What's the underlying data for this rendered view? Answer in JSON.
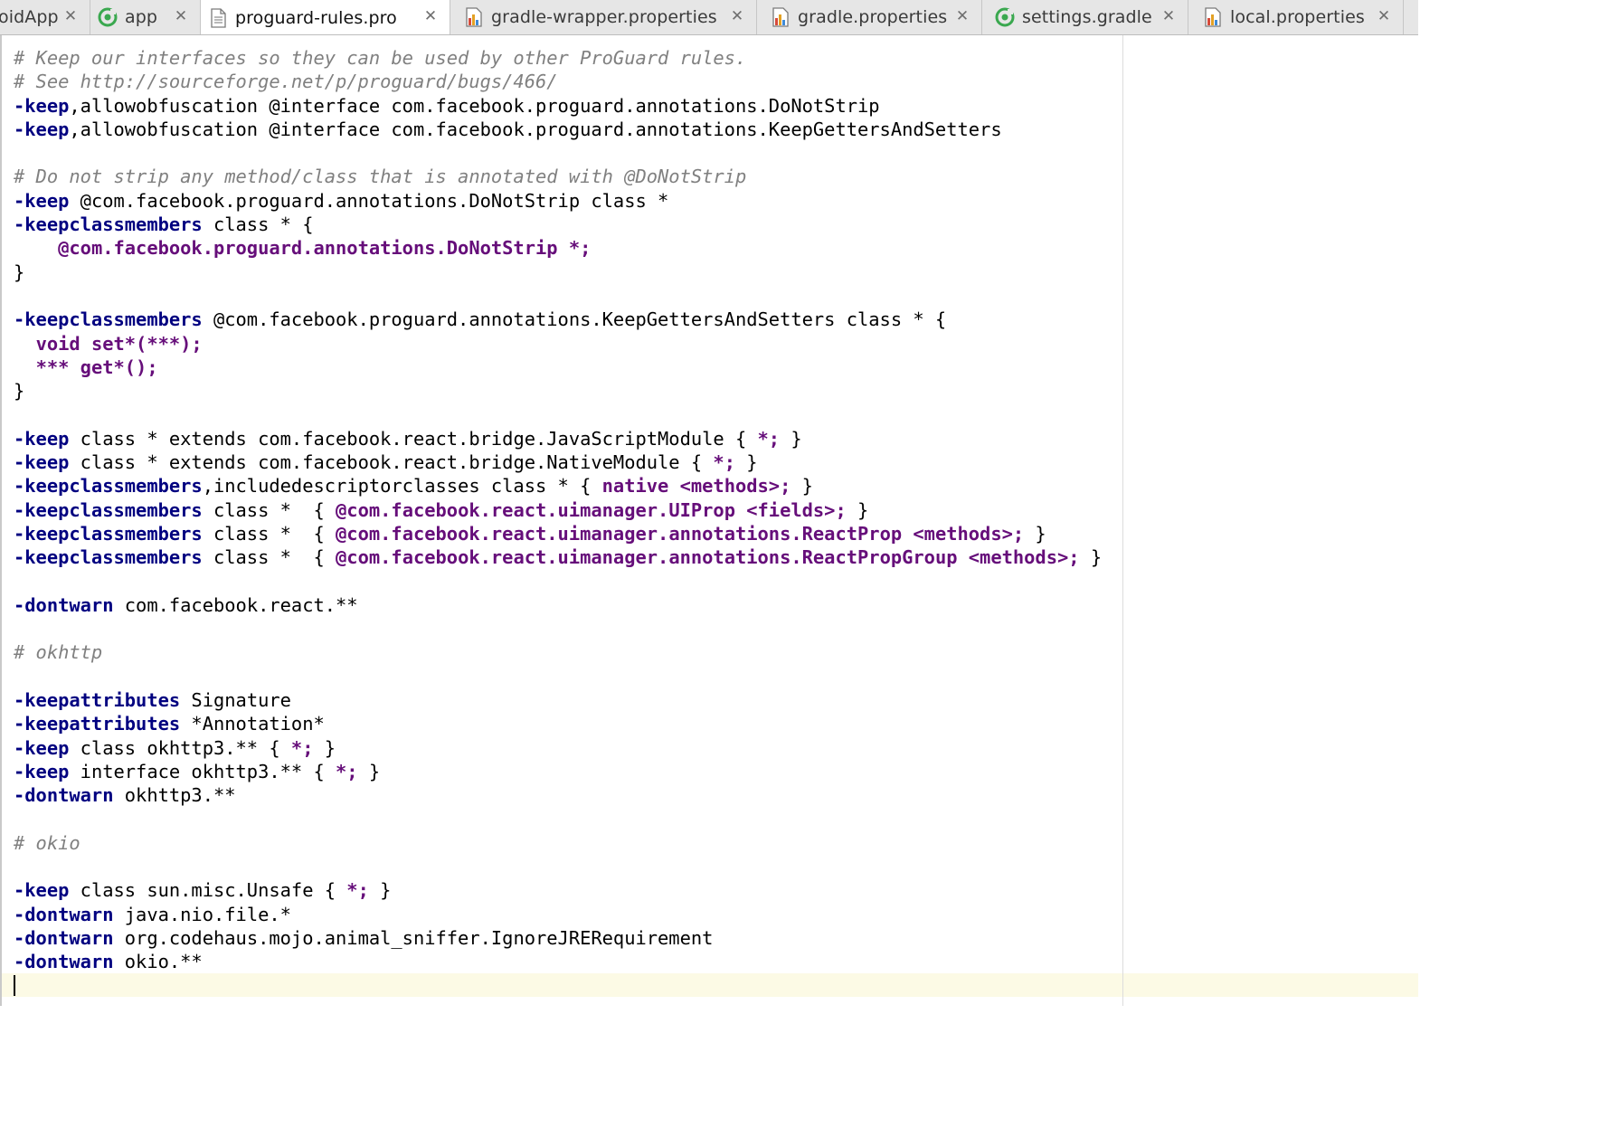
{
  "tabs": [
    {
      "label": "oidApp",
      "icon": "none",
      "active": false
    },
    {
      "label": "app",
      "icon": "gradle-module-icon",
      "active": false
    },
    {
      "label": "proguard-rules.pro",
      "icon": "text-file-icon",
      "active": true
    },
    {
      "label": "gradle-wrapper.properties",
      "icon": "properties-file-icon",
      "active": false
    },
    {
      "label": "gradle.properties",
      "icon": "properties-file-icon",
      "active": false
    },
    {
      "label": "settings.gradle",
      "icon": "gradle-module-icon",
      "active": false
    },
    {
      "label": "local.properties",
      "icon": "properties-file-icon",
      "active": false
    }
  ],
  "tab_close_glyph": "✕",
  "editor": {
    "file": "proguard-rules.pro",
    "colors": {
      "comment": "#808080",
      "keyword": "#000080",
      "member": "#660e7a",
      "current_line": "#fcfae5"
    },
    "lines": [
      [
        {
          "t": "comment",
          "v": "# Keep our interfaces so they can be used by other ProGuard rules."
        }
      ],
      [
        {
          "t": "comment",
          "v": "# See http://sourceforge.net/p/proguard/bugs/466/"
        }
      ],
      [
        {
          "t": "keyword",
          "v": "-keep"
        },
        {
          "t": "plain",
          "v": ",allowobfuscation @interface com.facebook.proguard.annotations.DoNotStrip"
        }
      ],
      [
        {
          "t": "keyword",
          "v": "-keep"
        },
        {
          "t": "plain",
          "v": ",allowobfuscation @interface com.facebook.proguard.annotations.KeepGettersAndSetters"
        }
      ],
      [],
      [
        {
          "t": "comment",
          "v": "# Do not strip any method/class that is annotated with @DoNotStrip"
        }
      ],
      [
        {
          "t": "keyword",
          "v": "-keep"
        },
        {
          "t": "plain",
          "v": " @com.facebook.proguard.annotations.DoNotStrip class *"
        }
      ],
      [
        {
          "t": "keyword",
          "v": "-keepclassmembers"
        },
        {
          "t": "plain",
          "v": " class * {"
        }
      ],
      [
        {
          "t": "plain",
          "v": "    "
        },
        {
          "t": "member",
          "v": "@com.facebook.proguard.annotations.DoNotStrip *;"
        }
      ],
      [
        {
          "t": "plain",
          "v": "}"
        }
      ],
      [],
      [
        {
          "t": "keyword",
          "v": "-keepclassmembers"
        },
        {
          "t": "plain",
          "v": " @com.facebook.proguard.annotations.KeepGettersAndSetters class * {"
        }
      ],
      [
        {
          "t": "plain",
          "v": "  "
        },
        {
          "t": "member",
          "v": "void set*(***);"
        }
      ],
      [
        {
          "t": "plain",
          "v": "  "
        },
        {
          "t": "member",
          "v": "*** get*();"
        }
      ],
      [
        {
          "t": "plain",
          "v": "}"
        }
      ],
      [],
      [
        {
          "t": "keyword",
          "v": "-keep"
        },
        {
          "t": "plain",
          "v": " class * extends com.facebook.react.bridge.JavaScriptModule { "
        },
        {
          "t": "member",
          "v": "*;"
        },
        {
          "t": "plain",
          "v": " }"
        }
      ],
      [
        {
          "t": "keyword",
          "v": "-keep"
        },
        {
          "t": "plain",
          "v": " class * extends com.facebook.react.bridge.NativeModule { "
        },
        {
          "t": "member",
          "v": "*;"
        },
        {
          "t": "plain",
          "v": " }"
        }
      ],
      [
        {
          "t": "keyword",
          "v": "-keepclassmembers"
        },
        {
          "t": "plain",
          "v": ",includedescriptorclasses class * { "
        },
        {
          "t": "member",
          "v": "native <methods>;"
        },
        {
          "t": "plain",
          "v": " }"
        }
      ],
      [
        {
          "t": "keyword",
          "v": "-keepclassmembers"
        },
        {
          "t": "plain",
          "v": " class *  { "
        },
        {
          "t": "member",
          "v": "@com.facebook.react.uimanager.UIProp <fields>;"
        },
        {
          "t": "plain",
          "v": " }"
        }
      ],
      [
        {
          "t": "keyword",
          "v": "-keepclassmembers"
        },
        {
          "t": "plain",
          "v": " class *  { "
        },
        {
          "t": "member",
          "v": "@com.facebook.react.uimanager.annotations.ReactProp <methods>;"
        },
        {
          "t": "plain",
          "v": " }"
        }
      ],
      [
        {
          "t": "keyword",
          "v": "-keepclassmembers"
        },
        {
          "t": "plain",
          "v": " class *  { "
        },
        {
          "t": "member",
          "v": "@com.facebook.react.uimanager.annotations.ReactPropGroup <methods>;"
        },
        {
          "t": "plain",
          "v": " }"
        }
      ],
      [],
      [
        {
          "t": "keyword",
          "v": "-dontwarn"
        },
        {
          "t": "plain",
          "v": " com.facebook.react.**"
        }
      ],
      [],
      [
        {
          "t": "comment",
          "v": "# okhttp"
        }
      ],
      [],
      [
        {
          "t": "keyword",
          "v": "-keepattributes"
        },
        {
          "t": "plain",
          "v": " Signature"
        }
      ],
      [
        {
          "t": "keyword",
          "v": "-keepattributes"
        },
        {
          "t": "plain",
          "v": " *Annotation*"
        }
      ],
      [
        {
          "t": "keyword",
          "v": "-keep"
        },
        {
          "t": "plain",
          "v": " class okhttp3.** { "
        },
        {
          "t": "member",
          "v": "*;"
        },
        {
          "t": "plain",
          "v": " }"
        }
      ],
      [
        {
          "t": "keyword",
          "v": "-keep"
        },
        {
          "t": "plain",
          "v": " interface okhttp3.** { "
        },
        {
          "t": "member",
          "v": "*;"
        },
        {
          "t": "plain",
          "v": " }"
        }
      ],
      [
        {
          "t": "keyword",
          "v": "-dontwarn"
        },
        {
          "t": "plain",
          "v": " okhttp3.**"
        }
      ],
      [],
      [
        {
          "t": "comment",
          "v": "# okio"
        }
      ],
      [],
      [
        {
          "t": "keyword",
          "v": "-keep"
        },
        {
          "t": "plain",
          "v": " class sun.misc.Unsafe { "
        },
        {
          "t": "member",
          "v": "*;"
        },
        {
          "t": "plain",
          "v": " }"
        }
      ],
      [
        {
          "t": "keyword",
          "v": "-dontwarn"
        },
        {
          "t": "plain",
          "v": " java.nio.file.*"
        }
      ],
      [
        {
          "t": "keyword",
          "v": "-dontwarn"
        },
        {
          "t": "plain",
          "v": " org.codehaus.mojo.animal_sniffer.IgnoreJRERequirement"
        }
      ],
      [
        {
          "t": "keyword",
          "v": "-dontwarn"
        },
        {
          "t": "plain",
          "v": " okio.**"
        }
      ],
      []
    ]
  }
}
